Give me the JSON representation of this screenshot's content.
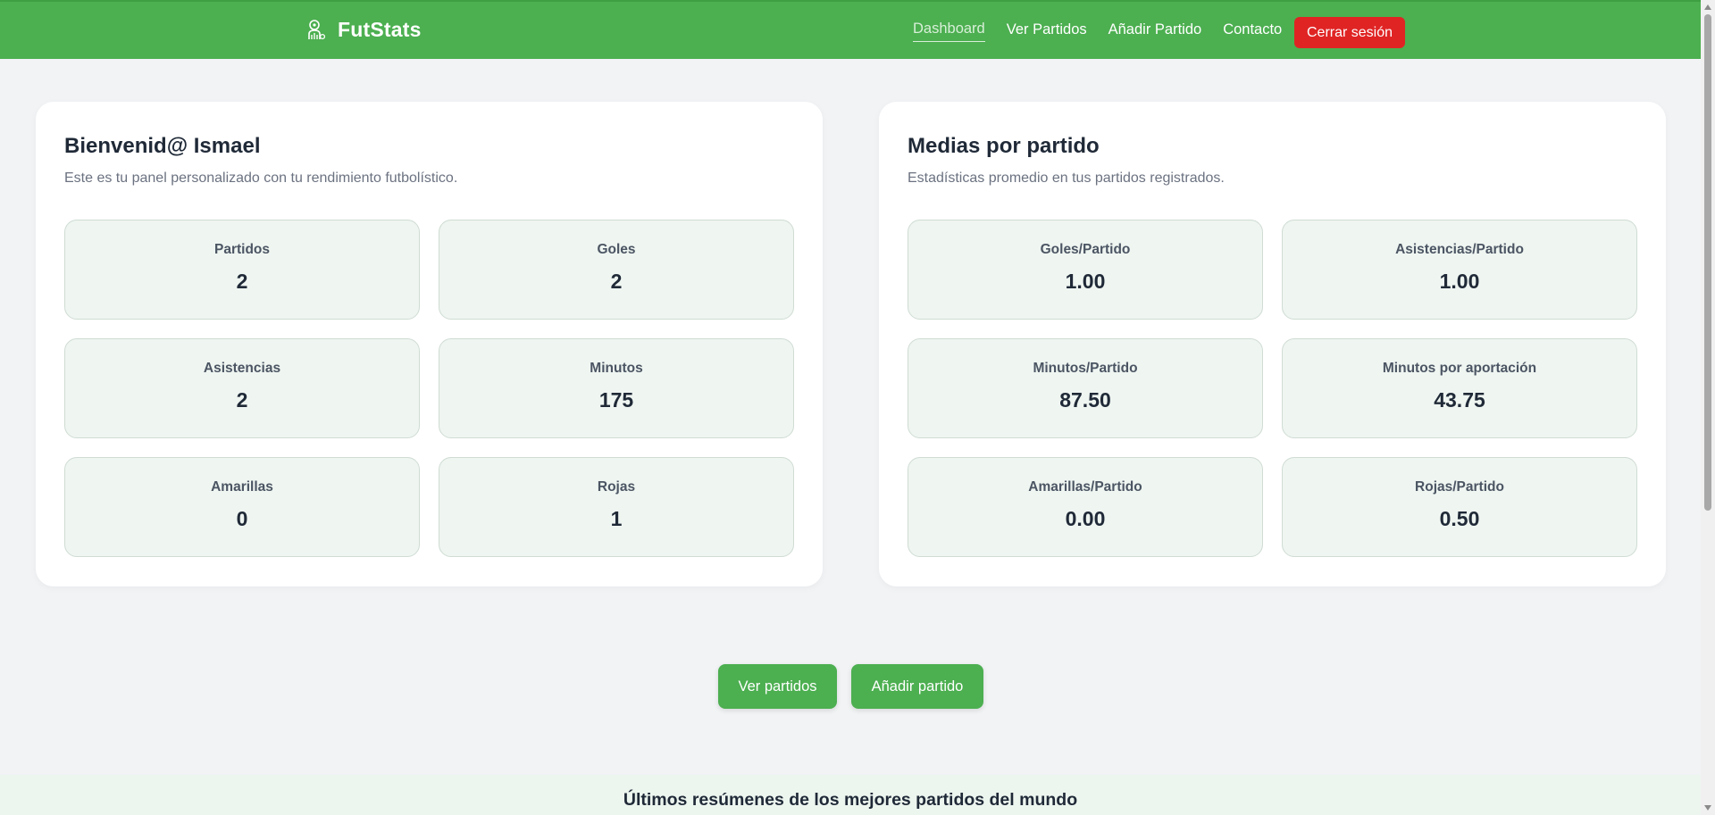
{
  "nav": {
    "brand": "FutStats",
    "brand_icon": "football-player-icon",
    "links": [
      "Dashboard",
      "Ver Partidos",
      "Añadir Partido",
      "Contacto"
    ],
    "active": "Dashboard",
    "logout_label": "Cerrar sesión"
  },
  "colors": {
    "primary": "#4caf50",
    "danger": "#e02424",
    "card_bg": "#eff5f1",
    "page_bg": "#f1f3f5"
  },
  "welcome": {
    "title": "Bienvenid@ Ismael",
    "subtitle": "Este es tu panel personalizado con tu rendimiento futbolístico.",
    "stats": [
      {
        "label": "Partidos",
        "value": "2"
      },
      {
        "label": "Goles",
        "value": "2"
      },
      {
        "label": "Asistencias",
        "value": "2"
      },
      {
        "label": "Minutos",
        "value": "175"
      },
      {
        "label": "Amarillas",
        "value": "0"
      },
      {
        "label": "Rojas",
        "value": "1"
      }
    ]
  },
  "averages": {
    "title": "Medias por partido",
    "subtitle": "Estadísticas promedio en tus partidos registrados.",
    "stats": [
      {
        "label": "Goles/Partido",
        "value": "1.00"
      },
      {
        "label": "Asistencias/Partido",
        "value": "1.00"
      },
      {
        "label": "Minutos/Partido",
        "value": "87.50"
      },
      {
        "label": "Minutos por aportación",
        "value": "43.75"
      },
      {
        "label": "Amarillas/Partido",
        "value": "0.00"
      },
      {
        "label": "Rojas/Partido",
        "value": "0.50"
      }
    ]
  },
  "actions": {
    "view_label": "Ver partidos",
    "add_label": "Añadir partido"
  },
  "highlights": {
    "title": "Últimos resúmenes de los mejores partidos del mundo"
  }
}
